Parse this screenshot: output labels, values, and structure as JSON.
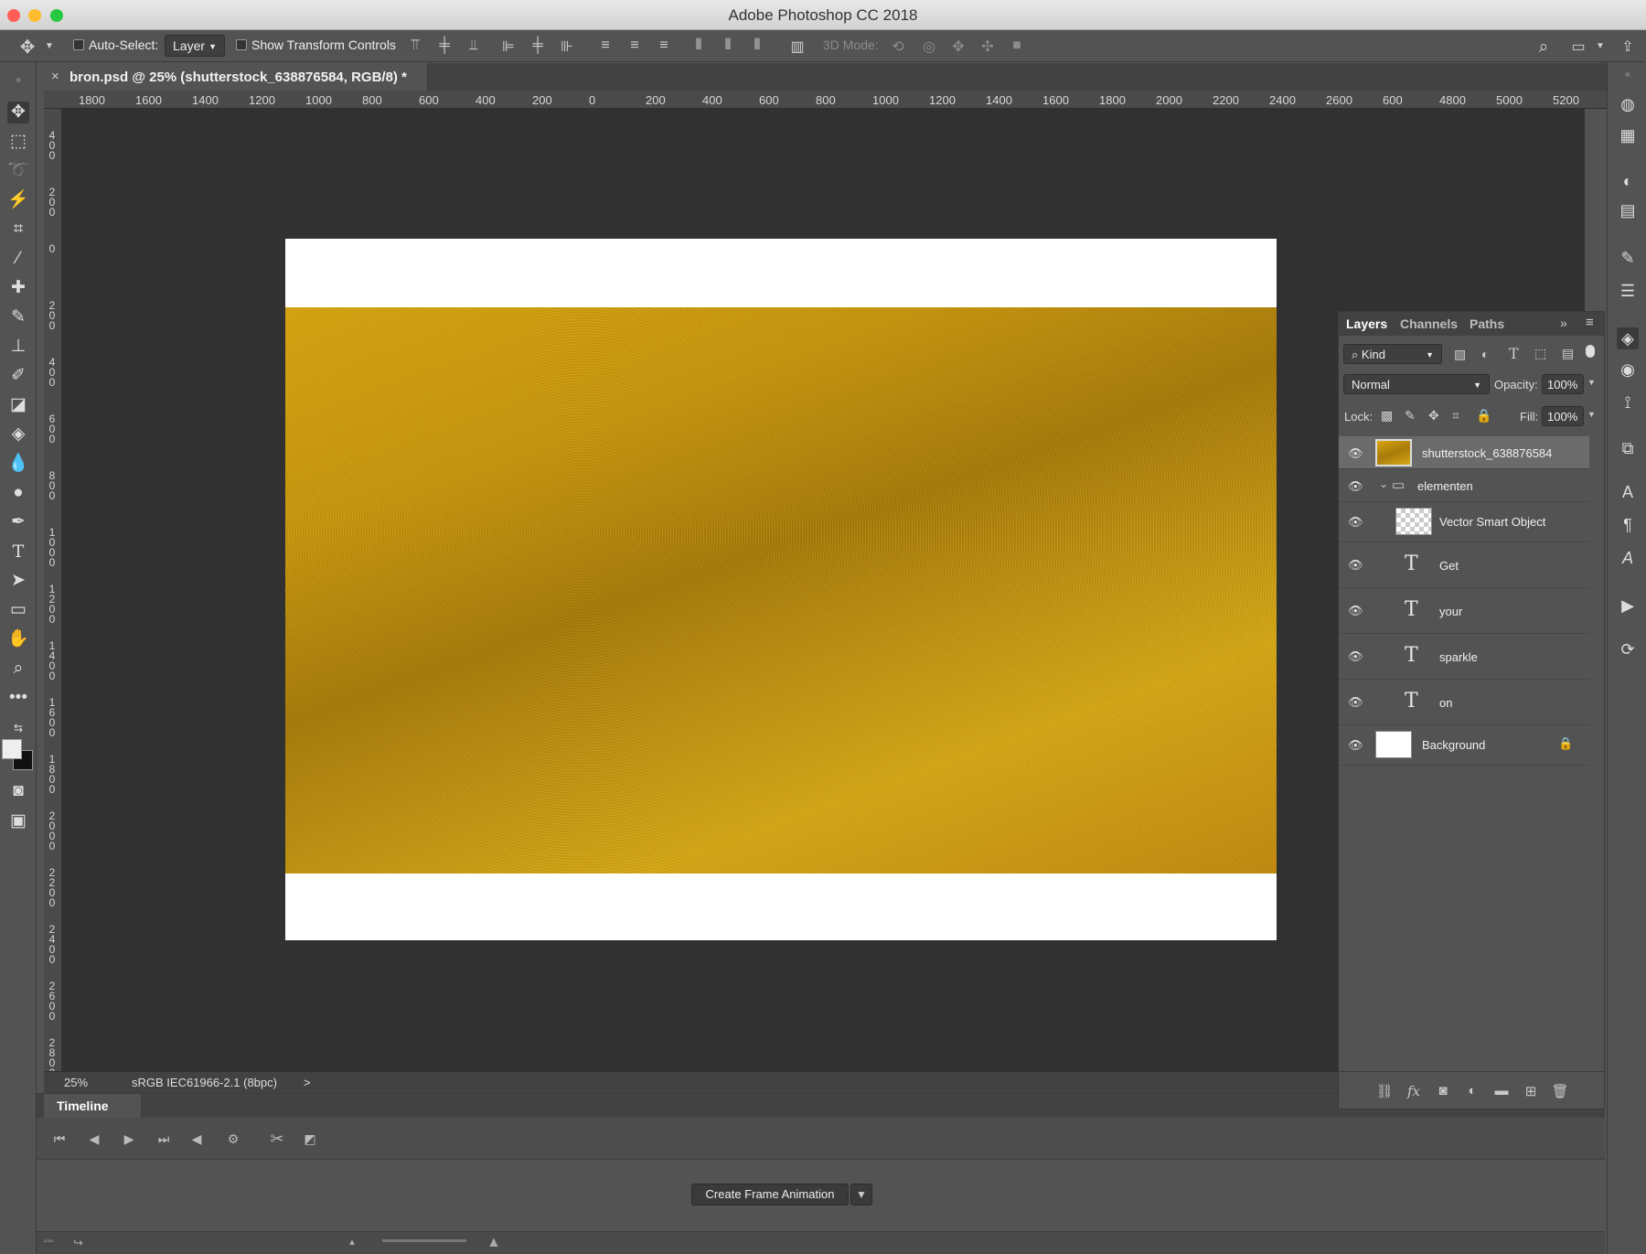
{
  "app": {
    "title": "Adobe Photoshop CC 2018",
    "colors": {
      "close": "#ff5f57",
      "minimize": "#febc2e",
      "zoom": "#28c840"
    }
  },
  "options_bar": {
    "auto_select_label": "Auto-Select:",
    "auto_select_value": "Layer",
    "show_transform_label": "Show Transform Controls",
    "three_d_mode_label": "3D Mode:"
  },
  "document": {
    "tab_title": "bron.psd @ 25% (shutterstock_638876584, RGB/8) *",
    "close_glyph": "×"
  },
  "ruler": {
    "h_ticks": [
      "1800",
      "1600",
      "1400",
      "1200",
      "1000",
      "800",
      "600",
      "400",
      "200",
      "0",
      "200",
      "400",
      "600",
      "800",
      "1000",
      "1200",
      "1400",
      "1600",
      "1800",
      "2000",
      "2200",
      "2400",
      "2600",
      "600",
      "4800",
      "5000",
      "5200"
    ],
    "v_ticks": [
      "400",
      "200",
      "0",
      "200",
      "400",
      "600",
      "800",
      "1000",
      "1200",
      "1400",
      "1600",
      "1800",
      "2000",
      "2200",
      "2400",
      "2600",
      "2800"
    ]
  },
  "status": {
    "zoom": "25%",
    "profile": "sRGB IEC61966-2.1 (8bpc)",
    "arrow": ">"
  },
  "timeline": {
    "tab_title": "Timeline",
    "create_button": "Create Frame Animation"
  },
  "layers_panel": {
    "tabs": [
      "Layers",
      "Channels",
      "Paths"
    ],
    "filter_kind": "Kind",
    "blend_mode": "Normal",
    "opacity_label": "Opacity:",
    "opacity_value": "100%",
    "lock_label": "Lock:",
    "fill_label": "Fill:",
    "fill_value": "100%",
    "layers": [
      {
        "name": "shutterstock_638876584",
        "type": "smart-image",
        "selected": true
      },
      {
        "name": "elementen",
        "type": "group"
      },
      {
        "name": "Vector Smart Object",
        "type": "smart-vector"
      },
      {
        "name": "Get",
        "type": "text"
      },
      {
        "name": "your",
        "type": "text"
      },
      {
        "name": "sparkle",
        "type": "text"
      },
      {
        "name": "on",
        "type": "text"
      },
      {
        "name": "Background",
        "type": "background",
        "locked": true
      }
    ]
  }
}
